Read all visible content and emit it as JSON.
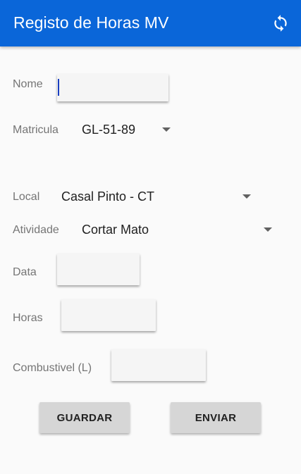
{
  "app": {
    "title": "Registo de Horas MV",
    "sync_icon": "sync-icon"
  },
  "form": {
    "nome": {
      "label": "Nome",
      "value": ""
    },
    "matricula": {
      "label": "Matricula",
      "value": "GL-51-89"
    },
    "local": {
      "label": "Local",
      "value": "Casal Pinto - CT"
    },
    "atividade": {
      "label": "Atividade",
      "value": "Cortar Mato"
    },
    "data": {
      "label": "Data",
      "value": ""
    },
    "horas": {
      "label": "Horas",
      "value": ""
    },
    "combustivel": {
      "label": "Combustivel (L)",
      "value": ""
    }
  },
  "actions": {
    "guardar": "GUARDAR",
    "enviar": "ENVIAR"
  },
  "colors": {
    "appbar": "#0a66d9",
    "background": "#fafafa",
    "button": "#d6d6d6"
  }
}
